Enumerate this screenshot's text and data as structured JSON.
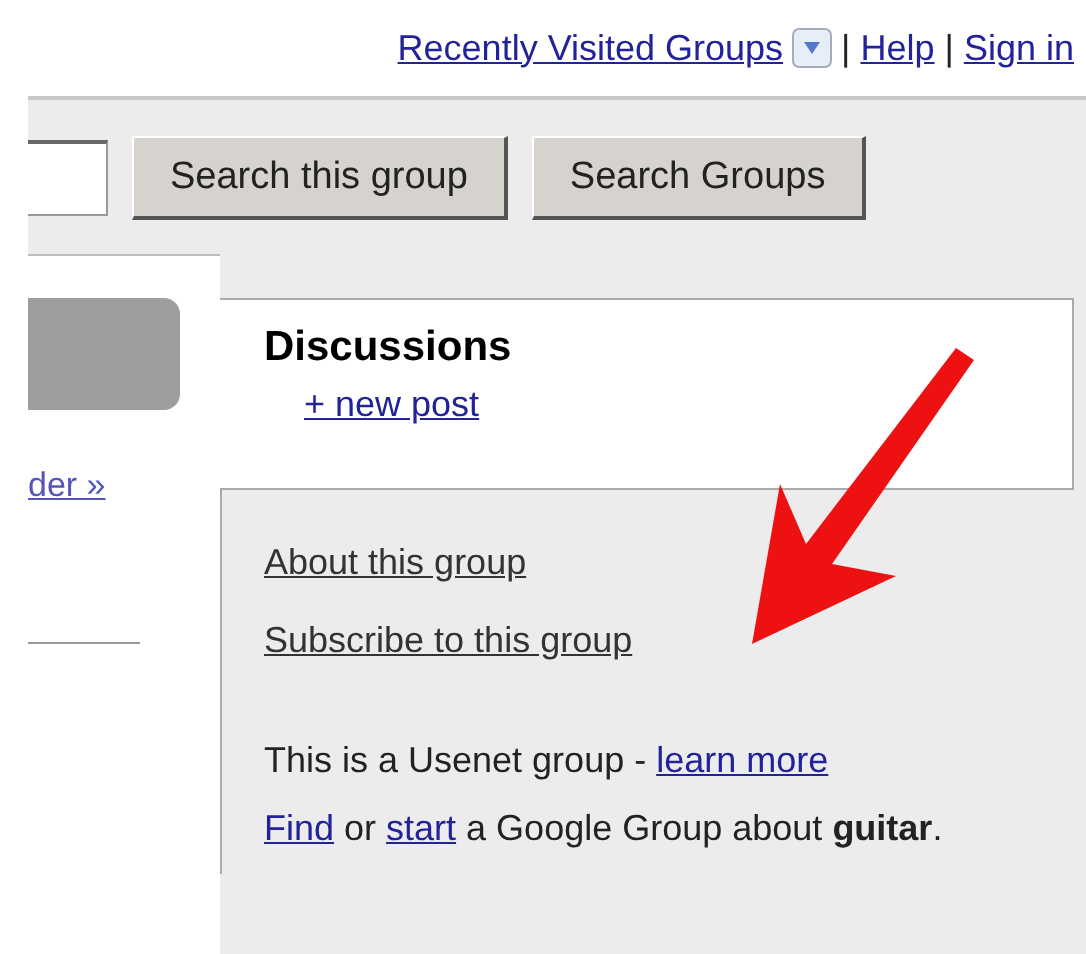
{
  "top_links": [
    {
      "kind": "dropdown",
      "label": "Recently Visited Groups"
    },
    {
      "kind": "separator",
      "label": "|"
    },
    {
      "kind": "link",
      "label": "Help"
    },
    {
      "kind": "separator",
      "label": "|"
    },
    {
      "kind": "link",
      "label": "Sign in"
    }
  ],
  "search": {
    "buttons": [
      "Search this group",
      "Search Groups"
    ]
  },
  "sidebar": {
    "link": "der »"
  },
  "discussions": {
    "title": "Discussions",
    "new_post": "+ new post"
  },
  "group_links": [
    "About this group",
    "Subscribe to this group"
  ],
  "info": [
    [
      {
        "kind": "text",
        "text": "This is a Usenet group - "
      },
      {
        "kind": "link",
        "text": "learn more"
      }
    ],
    [
      {
        "kind": "link",
        "text": "Find"
      },
      {
        "kind": "text",
        "text": " or "
      },
      {
        "kind": "link",
        "text": "start"
      },
      {
        "kind": "text",
        "text": " a Google Group about "
      },
      {
        "kind": "bold",
        "text": "guitar"
      },
      {
        "kind": "text",
        "text": "."
      }
    ]
  ]
}
